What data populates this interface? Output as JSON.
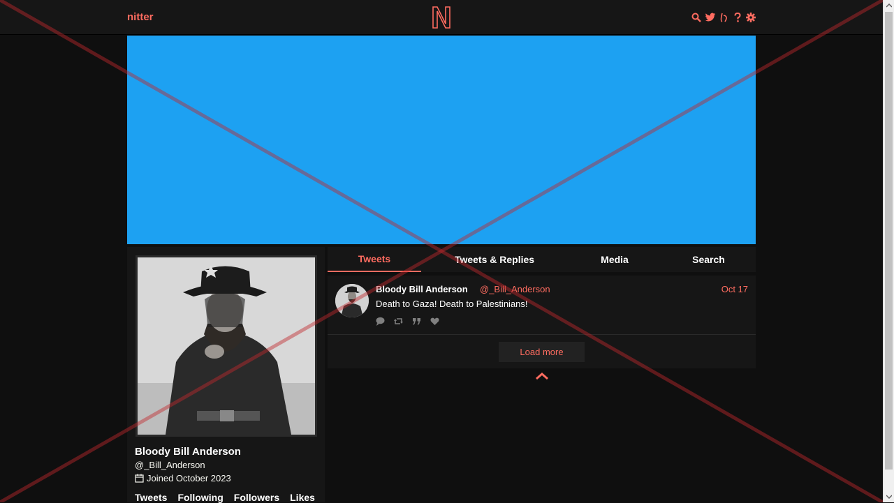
{
  "navbar": {
    "brand": "nitter",
    "icons": [
      "search-icon",
      "twitter-icon",
      "rss-icon",
      "help-icon",
      "settings-icon"
    ]
  },
  "colors": {
    "accent": "#ff6c60",
    "background": "#0f0f0f",
    "panel": "#161616",
    "banner": "#1da1f2"
  },
  "profile": {
    "fullname": "Bloody Bill Anderson",
    "username": "@_Bill_Anderson",
    "joined": "Joined October 2023",
    "stats": [
      "Tweets",
      "Following",
      "Followers",
      "Likes"
    ]
  },
  "tabs": [
    "Tweets",
    "Tweets & Replies",
    "Media",
    "Search"
  ],
  "tweet": {
    "fullname": "Bloody Bill Anderson",
    "username": "@_Bill_Anderson",
    "date": "Oct 17",
    "text": "Death to Gaza!  Death to Palestinians!",
    "actions": [
      "comment-icon",
      "retweet-icon",
      "quote-icon",
      "heart-icon"
    ]
  },
  "timeline": {
    "load_more": "Load more"
  }
}
